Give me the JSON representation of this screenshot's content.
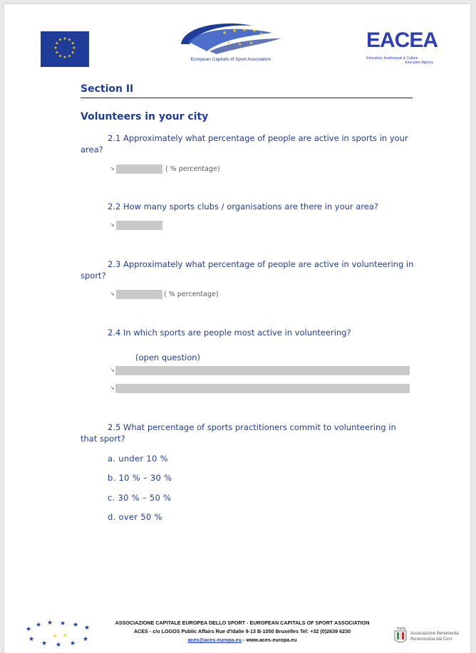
{
  "header": {
    "aces_org_name": "European Capitals of Sport Association",
    "eacea_word": "EACEA",
    "eacea_sub_line1": "Education, Audiovisual & Culture",
    "eacea_sub_line2": "Executive Agency"
  },
  "section": {
    "title": "Section II",
    "subtitle": "Volunteers in your city"
  },
  "questions": {
    "q1": {
      "number": "2.1",
      "text": "Approximately what percentage of people are active in sports in your area?",
      "unit": "( % percentage)"
    },
    "q2": {
      "number": "2.2",
      "text": "How many sports clubs / organisations are there in your area?"
    },
    "q3": {
      "number": "2.3",
      "text": "Approximately what percentage of people are active in volunteering in sport?",
      "unit": "( % percentage)"
    },
    "q4": {
      "number": "2.4",
      "text": "In which sports are people most active in volunteering?",
      "note": "(open question)"
    },
    "q5": {
      "number": "2.5",
      "text": "What percentage of sports practitioners commit to volunteering in that sport?"
    }
  },
  "options": [
    "a. under 10 %",
    "b. 10 % – 30 %",
    "c. 30 % – 50 %",
    "d. over 50 %"
  ],
  "footer": {
    "line1": "ASSOCIAZIONE CAPITALE EUROPEA DELLO SPORT - EUROPEAN CAPITALS OF SPORT ASSOCIATION",
    "line2": "ACES - c/o LOGOS Public Affairs Rue d'Idalie 9-13 B-1050 Bruxelles Tel: +32 (0)2639 6230",
    "email": "aces@aces-europa.eu",
    "separator": " - ",
    "website": "www.aces-europa.eu",
    "coni_italia": "Italia",
    "coni_line1": "Associazione Benemerita",
    "coni_line2": "Riconosciuta dal Coni"
  },
  "colors": {
    "heading_blue": "#1f3c99",
    "eu_flag_blue": "#1f3c99",
    "eu_star_yellow": "#f5d400",
    "field_gray": "#c9c9c9"
  }
}
